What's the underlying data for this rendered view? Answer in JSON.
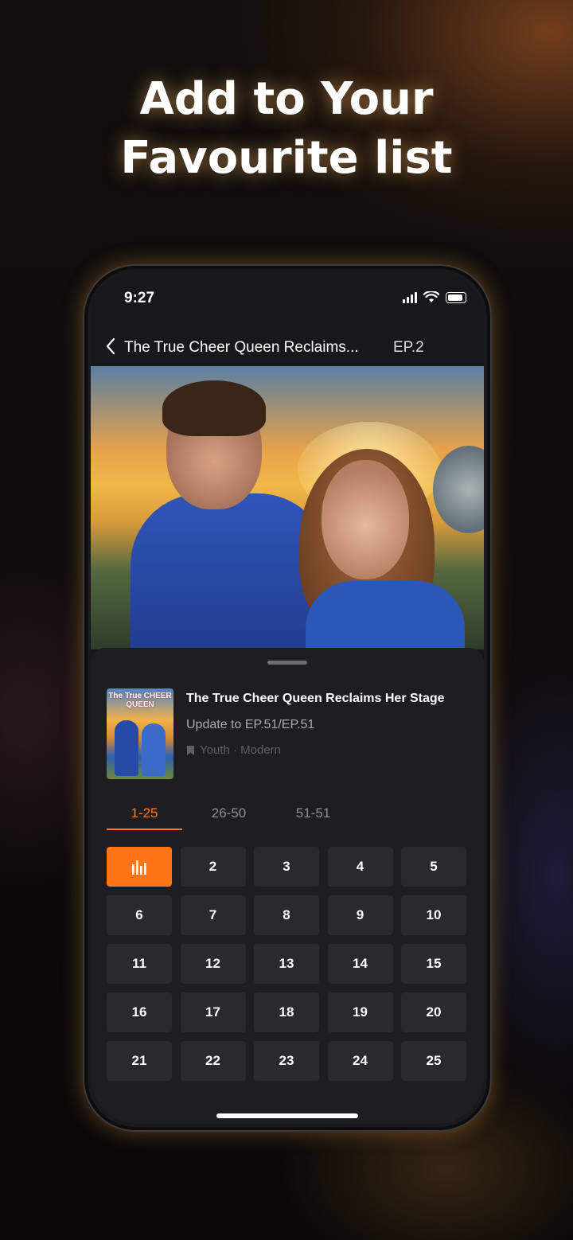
{
  "headline": {
    "line1": "Add to Your",
    "line2": "Favourite list"
  },
  "status_bar": {
    "time": "9:27"
  },
  "nav": {
    "title": "The True Cheer Queen Reclaims...",
    "episode": "EP.2"
  },
  "drama": {
    "cover_text": "The True CHEER QUEEN",
    "title": "The True Cheer Queen Reclaims Her Stage",
    "update": "Update to EP.51/EP.51",
    "tags": "Youth · Modern"
  },
  "tabs": [
    "1-25",
    "26-50",
    "51-51"
  ],
  "active_tab": 0,
  "episodes": {
    "playing": 1,
    "labels": [
      "",
      "2",
      "3",
      "4",
      "5",
      "6",
      "7",
      "8",
      "9",
      "10",
      "11",
      "12",
      "13",
      "14",
      "15",
      "16",
      "17",
      "18",
      "19",
      "20",
      "21",
      "22",
      "23",
      "24",
      "25"
    ]
  },
  "colors": {
    "accent": "#ff7417",
    "sheet_bg": "#1e1e22",
    "cell_bg": "#2a2a2e"
  }
}
